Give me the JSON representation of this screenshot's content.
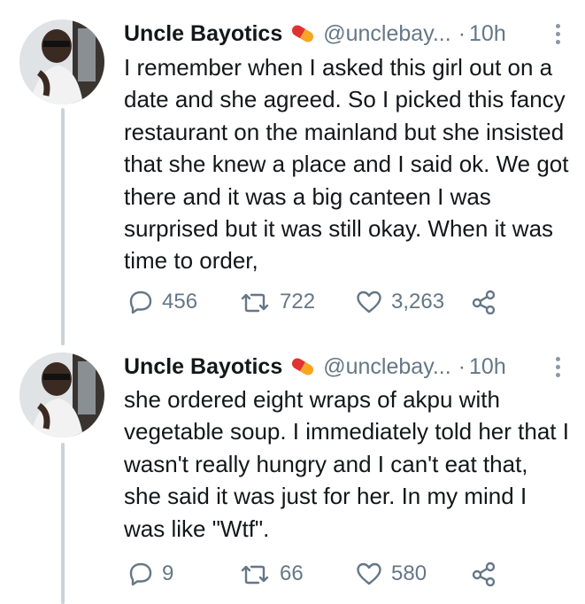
{
  "tweets": [
    {
      "name": "Uncle Bayotics",
      "handle": "@unclebay...",
      "separator": "·",
      "time": "10h",
      "text": "I remember when I asked this girl out on a date and she agreed. So I picked this fancy restaurant on the mainland but she insisted that she knew a place and I said ok. We got there and it was a big canteen I was surprised but it was still okay. When it was time to order,",
      "replies": "456",
      "retweets": "722",
      "likes": "3,263"
    },
    {
      "name": "Uncle Bayotics",
      "handle": "@unclebay...",
      "separator": "·",
      "time": "10h",
      "text": "she ordered eight wraps of akpu with vegetable soup. I immediately told her that I wasn't really hungry and I can't eat that, she said it was just for her. In my mind I was like \"Wtf\".",
      "replies": "9",
      "retweets": "66",
      "likes": "580"
    }
  ],
  "icons": {
    "name_emoji": "pill-emoji",
    "more": "more-vertical-icon",
    "reply": "reply-icon",
    "retweet": "retweet-icon",
    "like": "heart-icon",
    "share": "share-icon"
  },
  "colors": {
    "icon_gray": "#657786",
    "thread_line": "#c8d3dc",
    "pill_red": "#e0322f",
    "pill_yellow": "#f6a623"
  }
}
